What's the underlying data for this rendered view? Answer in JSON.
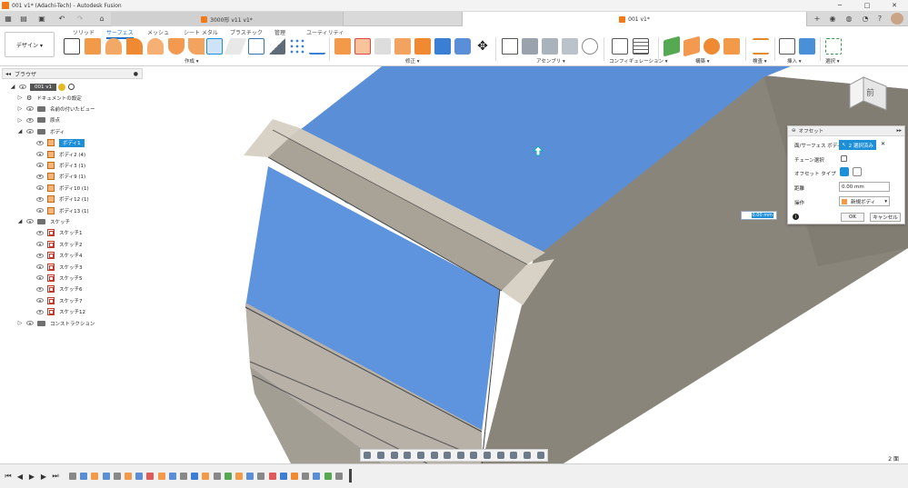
{
  "window": {
    "title": "001 v1* (Adachi-Tech) - Autodesk Fusion",
    "minimize": "─",
    "maximize": "□",
    "close": "✕"
  },
  "tabs": [
    {
      "label": "3000形 v11 v1*",
      "active": false
    },
    {
      "label": "001 v1*",
      "active": true
    }
  ],
  "toolbar": {
    "workspace_button": "デザイン ▾",
    "workspace_tabs": [
      "ソリッド",
      "サーフェス",
      "メッシュ",
      "シート メタル",
      "プラスチック",
      "管理",
      "ユーティリティ"
    ],
    "active_tab": "サーフェス",
    "groups": [
      "作成 ▾",
      "修正 ▾",
      "アセンブリ ▾",
      "コンフィギュレーション ▾",
      "構築 ▾",
      "検査 ▾",
      "挿入 ▾",
      "選択 ▾"
    ]
  },
  "browser": {
    "title": "ブラウザ",
    "root": "001 v1",
    "items": [
      {
        "label": "ドキュメントの設定",
        "icon": "gear-icon",
        "level": 1
      },
      {
        "label": "名前の付いたビュー",
        "icon": "folder-icon",
        "level": 1
      },
      {
        "label": "原点",
        "icon": "folder-icon",
        "level": 1
      },
      {
        "label": "ボディ",
        "icon": "folder-icon",
        "level": 1
      },
      {
        "label": "ボディ1",
        "icon": "body-icon",
        "level": 2,
        "selected": true
      },
      {
        "label": "ボディ2 (4)",
        "icon": "body-icon",
        "level": 2
      },
      {
        "label": "ボディ3 (1)",
        "icon": "body-icon",
        "level": 2
      },
      {
        "label": "ボディ9 (1)",
        "icon": "body-icon",
        "level": 2
      },
      {
        "label": "ボディ10 (1)",
        "icon": "body-icon",
        "level": 2
      },
      {
        "label": "ボディ12 (1)",
        "icon": "body-icon",
        "level": 2
      },
      {
        "label": "ボディ13 (1)",
        "icon": "body-icon",
        "level": 2
      },
      {
        "label": "スケッチ",
        "icon": "folder-icon",
        "level": 1
      },
      {
        "label": "スケッチ1",
        "icon": "sketch-icon",
        "level": 2
      },
      {
        "label": "スケッチ2",
        "icon": "sketch-icon",
        "level": 2
      },
      {
        "label": "スケッチ4",
        "icon": "sketch-icon",
        "level": 2
      },
      {
        "label": "スケッチ3",
        "icon": "sketch-icon",
        "level": 2
      },
      {
        "label": "スケッチ5",
        "icon": "sketch-icon",
        "level": 2
      },
      {
        "label": "スケッチ6",
        "icon": "sketch-icon",
        "level": 2
      },
      {
        "label": "スケッチ7",
        "icon": "sketch-icon",
        "level": 2
      },
      {
        "label": "スケッチ12",
        "icon": "sketch-icon",
        "level": 2
      },
      {
        "label": "コンストラクション",
        "icon": "folder-icon",
        "level": 1
      }
    ]
  },
  "offset_panel": {
    "title": "オフセット",
    "face_label": "面/サーフェス ボディ",
    "selection_button": "2 選択済み",
    "clear": "✕",
    "chain_label": "チェーン選択",
    "type_label": "オフセット タイプ",
    "distance_label": "距離",
    "distance_value": "0.00 mm",
    "operation_label": "操作",
    "operation_value": "新規ボディ",
    "ok": "OK",
    "cancel": "キャンセル"
  },
  "inline_distance": "0.00 mm",
  "status": {
    "selection_count": "2 面"
  },
  "viewcube": {
    "front_label": "前"
  },
  "colors": {
    "accent": "#1d8fd8",
    "selected_face": "#5a8fd8",
    "body_grey": "#8a857b",
    "titlebar": "#f3f3f3"
  }
}
